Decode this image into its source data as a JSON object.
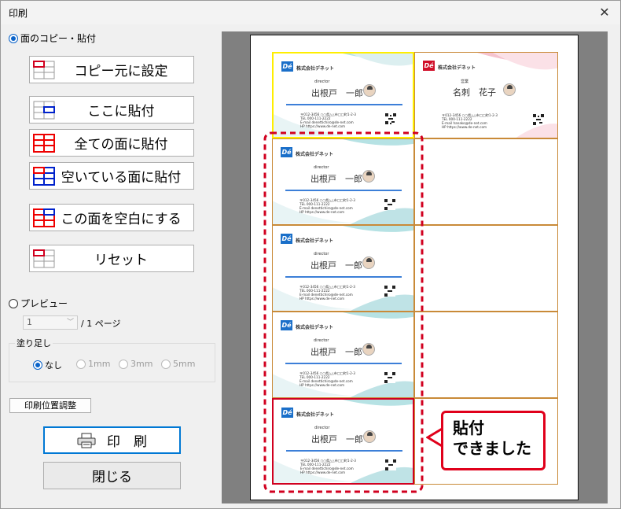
{
  "window": {
    "title": "印刷",
    "close_glyph": "✕"
  },
  "mode_copy": {
    "label": "面のコピー・貼付",
    "selected": true
  },
  "actions": [
    {
      "id": "set-source",
      "label": "コピー元に設定"
    },
    {
      "id": "paste-here",
      "label": "ここに貼付"
    },
    {
      "id": "paste-all",
      "label": "全ての面に貼付"
    },
    {
      "id": "paste-empty",
      "label": "空いている面に貼付"
    },
    {
      "id": "clear-face",
      "label": "この面を空白にする"
    },
    {
      "id": "reset",
      "label": "リセット"
    }
  ],
  "mode_preview": {
    "label": "プレビュー",
    "selected": false
  },
  "page_select": {
    "value": "1",
    "suffix": "/ 1 ページ"
  },
  "bleed": {
    "label": "塗り足し",
    "options": [
      {
        "label": "なし",
        "selected": true,
        "enabled": true
      },
      {
        "label": "1mm",
        "selected": false,
        "enabled": false
      },
      {
        "label": "3mm",
        "selected": false,
        "enabled": false
      },
      {
        "label": "5mm",
        "selected": false,
        "enabled": false
      }
    ]
  },
  "adjust_button": "印刷位置調整",
  "print_button": "印　刷",
  "close_button": "閉じる",
  "card_a": {
    "company": "株式会社デネット",
    "role": "director",
    "name": "出根戸　一郎",
    "address": [
      "〒012-3456 ○○県△△市□□町1-2-3",
      "TEL 000-111-2222",
      "E-mail denettichiro@de-net.com",
      "HP https://www.de-net.com"
    ]
  },
  "card_b": {
    "company": "株式会社デネット",
    "role": "営業",
    "name": "名刺　花子",
    "address": [
      "〒012-3456 ○○県△△市□□町1-2-3",
      "TEL 000-111-2222",
      "E-mail hanako@de-net.com",
      "HP https://www.de-net.com"
    ]
  },
  "annotation": {
    "line1": "貼付",
    "line2": "できました"
  },
  "colors": {
    "accent": "#0a63c9",
    "highlight": "#ffee00",
    "selected_red": "#d1001f",
    "cell_border": "#c98a38",
    "logo_blue": "#1a6fc9",
    "logo_red": "#d1102a"
  }
}
